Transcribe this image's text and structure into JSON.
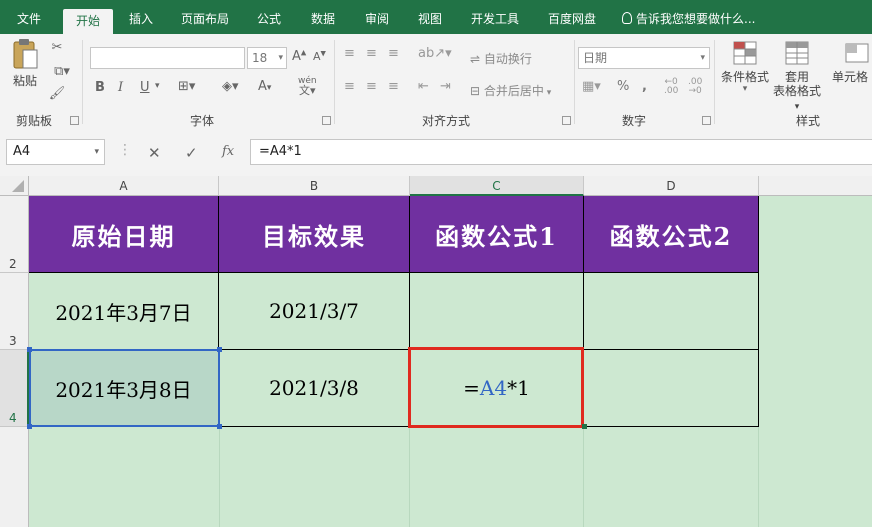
{
  "ribbon_tabs": [
    "文件",
    "开始",
    "插入",
    "页面布局",
    "公式",
    "数据",
    "审阅",
    "视图",
    "开发工具",
    "百度网盘"
  ],
  "active_tab": "开始",
  "tell_me": "告诉我您想要做什么...",
  "clipboard": {
    "paste_label": "粘贴",
    "group_label": "剪贴板"
  },
  "font": {
    "name_value": "",
    "size_value": "18",
    "bold": "B",
    "italic": "I",
    "underline": "U",
    "font_color": "A",
    "phonetic": "wén",
    "group_label": "字体"
  },
  "alignment": {
    "wrap_text": "自动换行",
    "merge_center": "合并后居中",
    "group_label": "对齐方式"
  },
  "number": {
    "format_value": "日期",
    "percent": "%",
    "comma": ",",
    "group_label": "数字"
  },
  "styles": {
    "conditional_format": "条件格式",
    "table_format_1": "套用",
    "table_format_2": "表格格式",
    "cell_styles": "单元格",
    "group_label": "样式"
  },
  "formula_bar": {
    "name_box": "A4",
    "cancel": "✕",
    "enter": "✓",
    "fx": "fx",
    "formula": "=A4*1"
  },
  "columns": [
    "A",
    "B",
    "C",
    "D"
  ],
  "rows": [
    "2",
    "3",
    "4"
  ],
  "table": {
    "headers": [
      "原始日期",
      "目标效果",
      "函数公式1",
      "函数公式2"
    ],
    "row3": [
      "2021年3月7日",
      "2021/3/7",
      "",
      ""
    ],
    "row4": [
      "2021年3月8日",
      "2021/3/8",
      "",
      ""
    ]
  },
  "editing_cell": {
    "eq": "=",
    "ref": "A4",
    "rest": "*1"
  },
  "colors": {
    "excel_green": "#217346",
    "header_purple": "#7030a0",
    "sheet_bg": "#cde8d1",
    "edit_border": "#e02a1f",
    "ref_blue": "#3266c5"
  }
}
